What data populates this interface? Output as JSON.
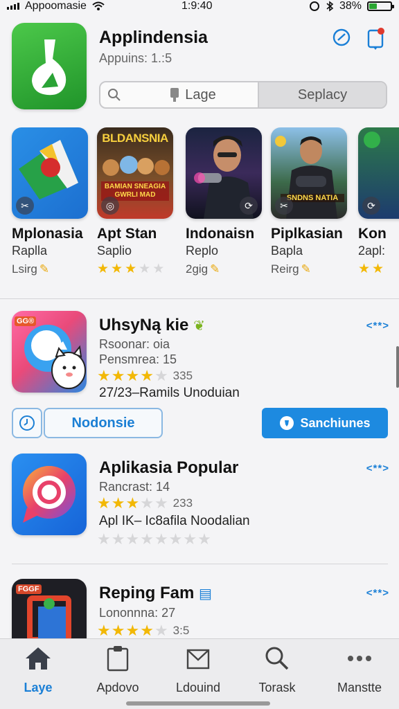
{
  "status": {
    "carrier": "Appoomasie",
    "time": "1:9:40",
    "battery": "38%",
    "battery_level": 0.38
  },
  "header": {
    "title": "Applindensia",
    "subtitle": "Appuins: 1.:5",
    "segment_left": "Lage",
    "segment_right": "Seplacy"
  },
  "carousel": [
    {
      "title": "Mplonasia",
      "sub": "Raplla",
      "meta": "Lsirg",
      "stars": 0
    },
    {
      "title": "Apt Stan",
      "sub": "Saplio",
      "meta": "",
      "stars": 3,
      "art_text": "BLDANSNIA",
      "art_text2": "BAMIAN SNEAGIA GWRLI MAD"
    },
    {
      "title": "Indonaisn",
      "sub": "Replo",
      "meta": "2gig",
      "stars": 0
    },
    {
      "title": "Piplkasian",
      "sub": "Bapla",
      "meta": "Reirg",
      "stars": 0,
      "art_text": "SNDNS NATIA"
    },
    {
      "title": "Kon",
      "sub": "2apl:",
      "meta": "",
      "stars": 2
    }
  ],
  "featured": {
    "badge": "GG®",
    "title": "UhsyNą kie",
    "line1": "Rsoonar: oia",
    "line2": "Pensmrea: 15",
    "rating_count": "335",
    "rating": 4,
    "date_line": "27/23–Ramils Unoduian",
    "more": "<**>"
  },
  "actions": {
    "outline_label": "Nodonsie",
    "primary_label": "Sanchiunes"
  },
  "popular": {
    "title": "Aplikasia Popular",
    "line1": "Rancrast: 14",
    "rating_count": "233",
    "rating": 3,
    "date_line": "Apl IK– Ic8afila Noodalian",
    "more": "<**>"
  },
  "third": {
    "badge": "FGGF",
    "title": "Reping Fam",
    "line1": "Lononnna: 27",
    "rating_count": "3:5",
    "rating": 4,
    "more": "<**>"
  },
  "tabs": [
    {
      "label": "Laye",
      "icon": "home-icon"
    },
    {
      "label": "Apdovo",
      "icon": "clipboard-icon"
    },
    {
      "label": "Ldouind",
      "icon": "mail-icon"
    },
    {
      "label": "Torask",
      "icon": "search-icon"
    },
    {
      "label": "Manstte",
      "icon": "more-icon"
    }
  ],
  "colors": {
    "accent": "#1d8ae0",
    "star": "#f2b806",
    "green": "#2ba632"
  }
}
